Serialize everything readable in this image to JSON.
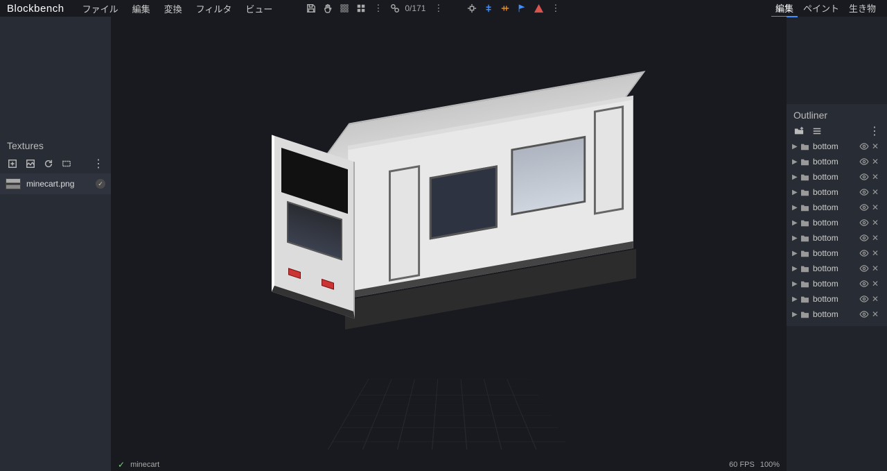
{
  "app": {
    "brand": "Blockbench"
  },
  "menu": [
    "ファイル",
    "編集",
    "変換",
    "フィルタ",
    "ビュー"
  ],
  "toolbar": {
    "counter": "0/171"
  },
  "modes": {
    "edit": "編集",
    "paint": "ペイント",
    "animate": "生き物"
  },
  "left": {
    "title": "Textures",
    "textures": [
      {
        "name": "minecart.png"
      }
    ]
  },
  "right": {
    "title": "Outliner",
    "items": [
      {
        "name": "bottom"
      },
      {
        "name": "bottom"
      },
      {
        "name": "bottom"
      },
      {
        "name": "bottom"
      },
      {
        "name": "bottom"
      },
      {
        "name": "bottom"
      },
      {
        "name": "bottom"
      },
      {
        "name": "bottom"
      },
      {
        "name": "bottom"
      },
      {
        "name": "bottom"
      },
      {
        "name": "bottom"
      },
      {
        "name": "bottom"
      }
    ]
  },
  "status": {
    "project": "minecart",
    "fps": "60 FPS",
    "zoom": "100%"
  }
}
